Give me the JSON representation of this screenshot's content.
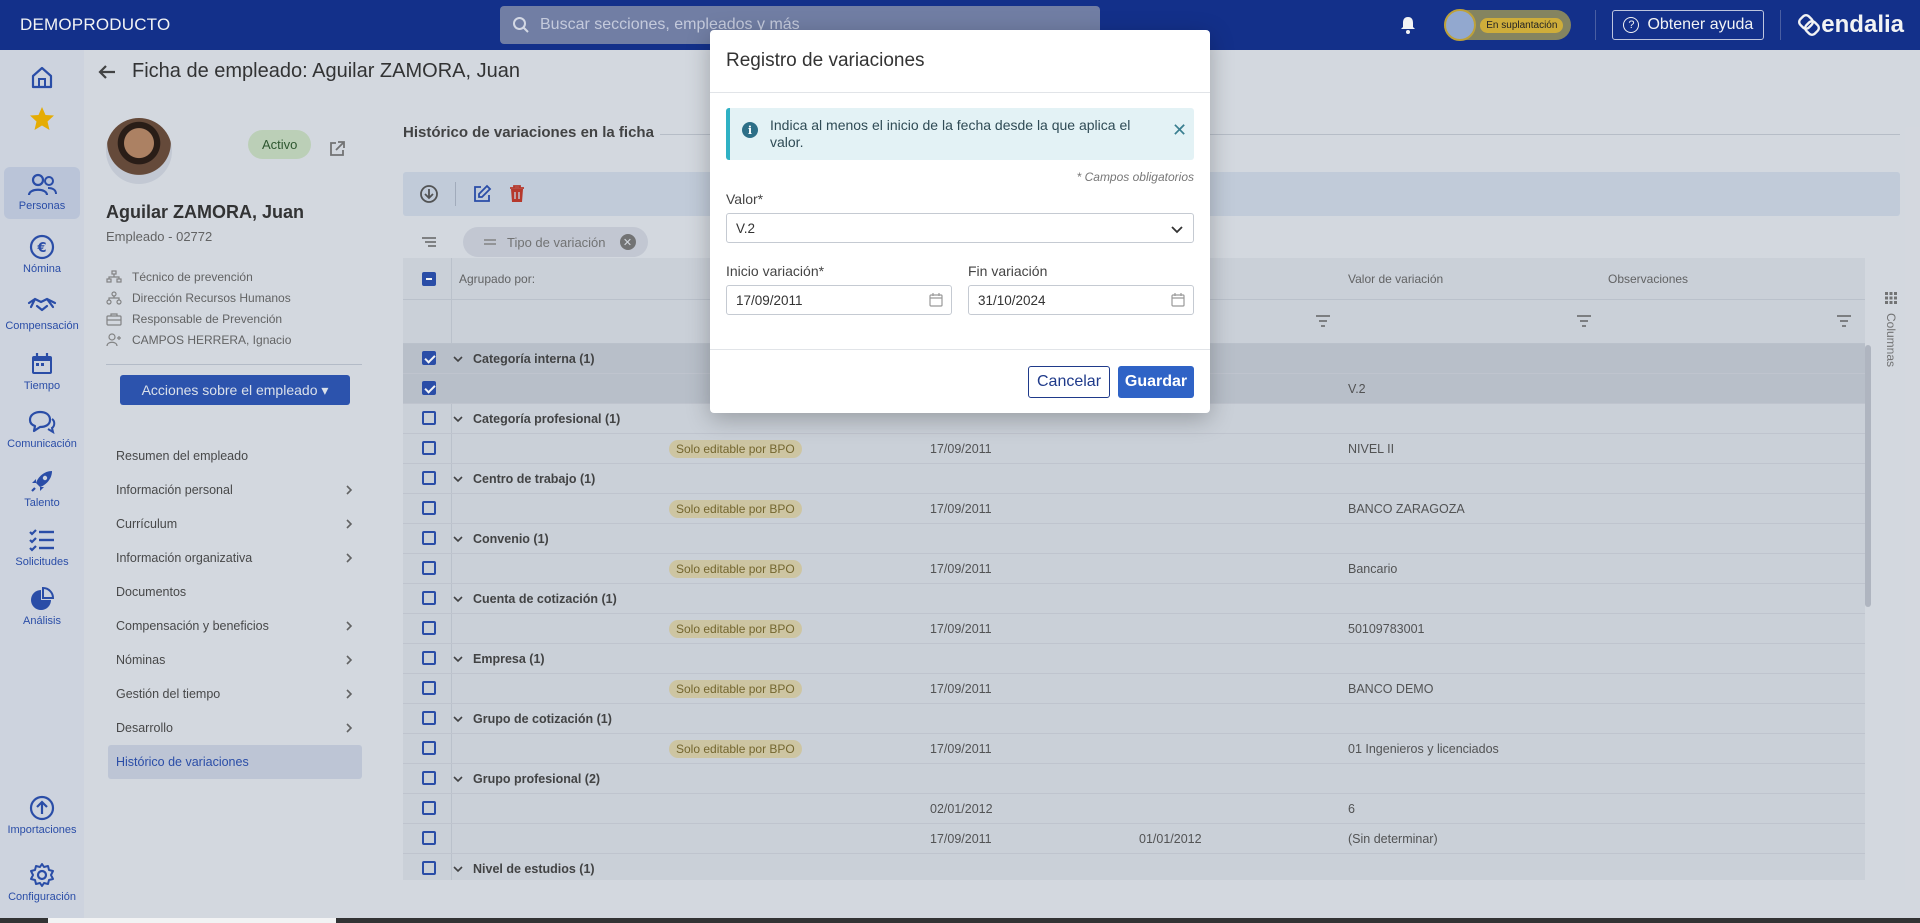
{
  "topbar": {
    "brand": "DEMOPRODUCTO",
    "search_placeholder": "Buscar secciones, empleados y más",
    "impersonation_badge": "En suplantación",
    "help_label": "Obtener ayuda",
    "logo_text": "endalia"
  },
  "rail": {
    "items": [
      {
        "label": "",
        "icon": "home-icon"
      },
      {
        "label": "",
        "icon": "star-icon"
      },
      {
        "label": "Personas",
        "icon": "people-icon"
      },
      {
        "label": "Nómina",
        "icon": "euro-icon"
      },
      {
        "label": "Compensación",
        "icon": "handshake-icon"
      },
      {
        "label": "Tiempo",
        "icon": "calendar-icon"
      },
      {
        "label": "Comunicación",
        "icon": "chat-icon"
      },
      {
        "label": "Talento",
        "icon": "rocket-icon"
      },
      {
        "label": "Solicitudes",
        "icon": "checklist-icon"
      },
      {
        "label": "Análisis",
        "icon": "pie-chart-icon"
      },
      {
        "label": "Importaciones",
        "icon": "upload-icon"
      },
      {
        "label": "Configuración",
        "icon": "gear-icon"
      }
    ]
  },
  "page": {
    "title": "Ficha de empleado: Aguilar ZAMORA, Juan"
  },
  "profile": {
    "status": "Activo",
    "name": "Aguilar ZAMORA, Juan",
    "code": "Empleado - 02772",
    "info": [
      "Técnico de prevención",
      "Dirección Recursos Humanos",
      "Responsable de Prevención",
      "CAMPOS HERRERA, Ignacio"
    ],
    "actions_label": "Acciones sobre el empleado ▾"
  },
  "menu": {
    "items": [
      {
        "label": "Resumen del empleado",
        "chevron": false
      },
      {
        "label": "Información personal",
        "chevron": true
      },
      {
        "label": "Currículum",
        "chevron": true
      },
      {
        "label": "Información organizativa",
        "chevron": true
      },
      {
        "label": "Documentos",
        "chevron": false
      },
      {
        "label": "Compensación y beneficios",
        "chevron": true
      },
      {
        "label": "Nóminas",
        "chevron": true
      },
      {
        "label": "Gestión del tiempo",
        "chevron": true
      },
      {
        "label": "Desarrollo",
        "chevron": true
      },
      {
        "label": "Histórico de variaciones",
        "chevron": false
      }
    ]
  },
  "main": {
    "section_title": "Histórico de variaciones en la ficha",
    "group_chip": "Tipo de variación",
    "grouped_by": "Agrupado por:",
    "col_value": "Valor de variación",
    "col_obs": "Observaciones",
    "columns_tab": "Columnas",
    "bpo_label": "Solo editable por BPO",
    "rows": [
      {
        "kind": "group",
        "label": "Categoría interna (1)",
        "checked": true
      },
      {
        "kind": "data",
        "checked": true,
        "bpo": false,
        "start": "",
        "end": "",
        "value": "V.2"
      },
      {
        "kind": "group",
        "label": "Categoría profesional (1)",
        "checked": false
      },
      {
        "kind": "data",
        "checked": false,
        "bpo": true,
        "start": "17/09/2011",
        "end": "",
        "value": "NIVEL II"
      },
      {
        "kind": "group",
        "label": "Centro de trabajo (1)",
        "checked": false
      },
      {
        "kind": "data",
        "checked": false,
        "bpo": true,
        "start": "17/09/2011",
        "end": "",
        "value": "BANCO ZARAGOZA"
      },
      {
        "kind": "group",
        "label": "Convenio (1)",
        "checked": false
      },
      {
        "kind": "data",
        "checked": false,
        "bpo": true,
        "start": "17/09/2011",
        "end": "",
        "value": "Bancario"
      },
      {
        "kind": "group",
        "label": "Cuenta de cotización (1)",
        "checked": false
      },
      {
        "kind": "data",
        "checked": false,
        "bpo": true,
        "start": "17/09/2011",
        "end": "",
        "value": "50109783001"
      },
      {
        "kind": "group",
        "label": "Empresa (1)",
        "checked": false
      },
      {
        "kind": "data",
        "checked": false,
        "bpo": true,
        "start": "17/09/2011",
        "end": "",
        "value": "BANCO DEMO"
      },
      {
        "kind": "group",
        "label": "Grupo de cotización (1)",
        "checked": false
      },
      {
        "kind": "data",
        "checked": false,
        "bpo": true,
        "start": "17/09/2011",
        "end": "",
        "value": "01 Ingenieros y licenciados"
      },
      {
        "kind": "group",
        "label": "Grupo profesional (2)",
        "checked": false
      },
      {
        "kind": "data",
        "checked": false,
        "bpo": false,
        "start": "02/01/2012",
        "end": "",
        "value": "6"
      },
      {
        "kind": "data",
        "checked": false,
        "bpo": false,
        "start": "17/09/2011",
        "end": "01/01/2012",
        "value": "(Sin determinar)"
      },
      {
        "kind": "group",
        "label": "Nivel de estudios (1)",
        "checked": false
      }
    ]
  },
  "modal": {
    "title": "Registro de variaciones",
    "alert_text": "Indica al menos el inicio de la fecha desde la que aplica el valor.",
    "required_note": "* Campos obligatorios",
    "value_label": "Valor*",
    "value_selected": "V.2",
    "start_label": "Inicio variación*",
    "start_value": "17/09/2011",
    "end_label": "Fin variación",
    "end_value": "31/10/2024",
    "cancel_label": "Cancelar",
    "save_label": "Guardar"
  },
  "colors": {
    "topbar": "#13308f",
    "accent": "#2f63c6",
    "alert_border": "#2fb1c4"
  }
}
